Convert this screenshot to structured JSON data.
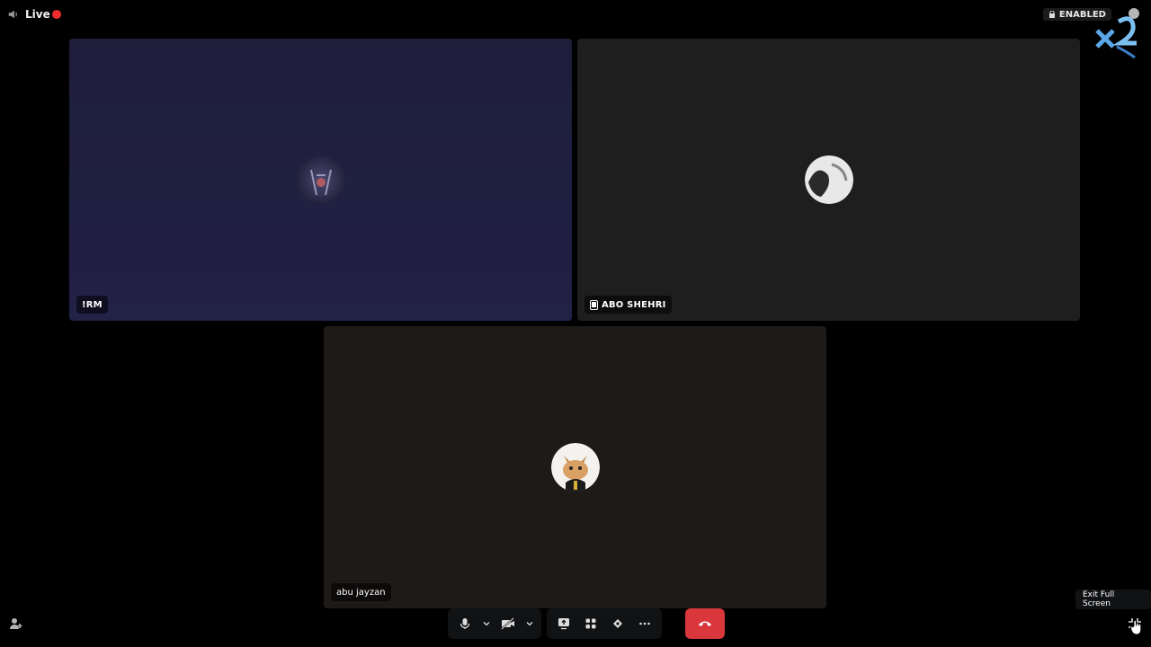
{
  "header": {
    "live_label": "Live",
    "enabled_label": "ENABLED",
    "live_color": "#ed2c2c"
  },
  "tiles": [
    {
      "name": "!RM",
      "background": "#221f45",
      "avatar": "dark-figure-avatar"
    },
    {
      "name": "ABO SHEHRI",
      "background": "#1e1e1e",
      "avatar": "monochrome-avatar",
      "device_icon": "phone-icon"
    },
    {
      "name": "abu jayzan",
      "background": "#1e1a17",
      "avatar": "cat-avatar"
    }
  ],
  "controls": {
    "buttons": [
      "microphone-icon",
      "chevron-down-icon",
      "camera-off-icon",
      "chevron-down-icon",
      "screen-share-icon",
      "activities-icon",
      "soundboard-icon",
      "more-icon"
    ],
    "hangup_icon": "hang-up-icon",
    "hangup_color": "#da373c"
  },
  "tooltip": {
    "text": "Exit Full Screen"
  }
}
